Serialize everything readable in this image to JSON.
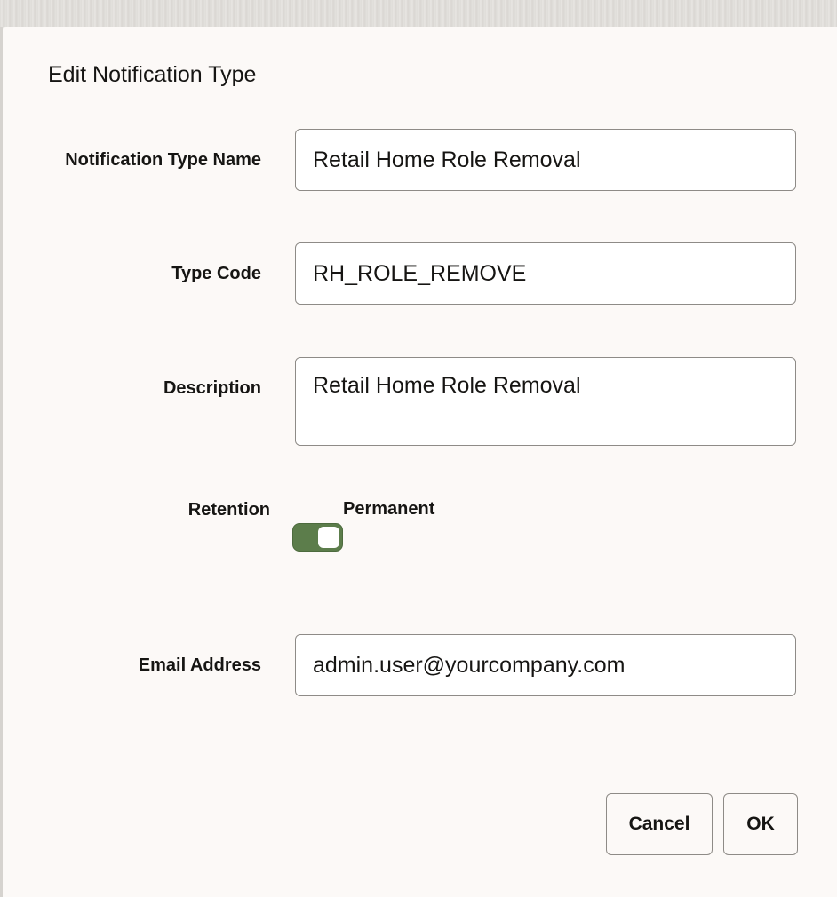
{
  "dialog": {
    "title": "Edit Notification Type",
    "fields": {
      "name": {
        "label": "Notification Type Name",
        "value": "Retail Home Role Removal"
      },
      "type_code": {
        "label": "Type Code",
        "value": "RH_ROLE_REMOVE"
      },
      "description": {
        "label": "Description",
        "value": "Retail Home Role Removal"
      },
      "retention": {
        "label": "Retention",
        "toggle_label": "Permanent",
        "checked": true
      },
      "email": {
        "label": "Email Address",
        "value": "admin.user@yourcompany.com"
      }
    },
    "buttons": {
      "cancel": "Cancel",
      "ok": "OK"
    }
  },
  "colors": {
    "toggle_on": "#5c7d4b",
    "dialog_background": "#fcf9f7"
  }
}
